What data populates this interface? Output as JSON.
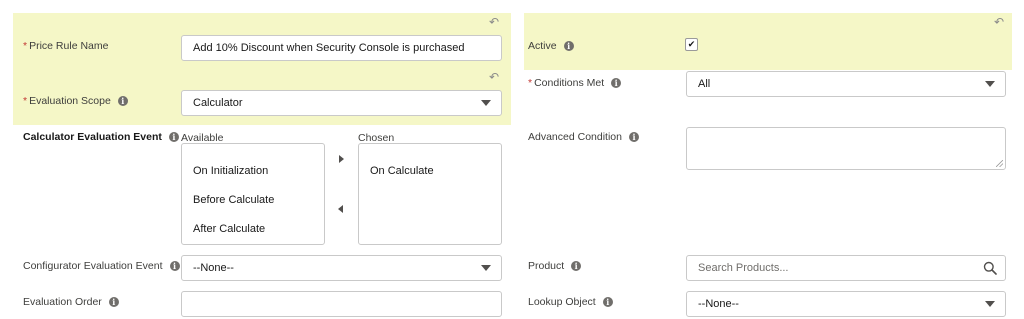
{
  "fields": {
    "price_rule_name": {
      "required_marker": "*",
      "label": "Price Rule Name",
      "value": "Add 10% Discount when Security Console is purchased"
    },
    "evaluation_scope": {
      "required_marker": "*",
      "label": "Evaluation Scope",
      "value": "Calculator"
    },
    "calculator_evaluation_event": {
      "label": "Calculator Evaluation Event",
      "available_label": "Available",
      "chosen_label": "Chosen",
      "available": [
        "On Initialization",
        "Before Calculate",
        "After Calculate"
      ],
      "chosen": [
        "On Calculate"
      ]
    },
    "configurator_evaluation_event": {
      "label": "Configurator Evaluation Event",
      "value": "--None--"
    },
    "evaluation_order": {
      "label": "Evaluation Order",
      "value": ""
    },
    "active": {
      "label": "Active",
      "checked": true
    },
    "conditions_met": {
      "required_marker": "*",
      "label": "Conditions Met",
      "value": "All"
    },
    "advanced_condition": {
      "label": "Advanced Condition",
      "value": ""
    },
    "product": {
      "label": "Product",
      "placeholder": "Search Products..."
    },
    "lookup_object": {
      "label": "Lookup Object",
      "value": "--None--"
    }
  },
  "icons": {
    "info": "i",
    "undo": "↶",
    "check": "✔"
  },
  "colors": {
    "highlight": "#f5f7c7",
    "required": "#c23934",
    "border": "#c9c9c9"
  }
}
